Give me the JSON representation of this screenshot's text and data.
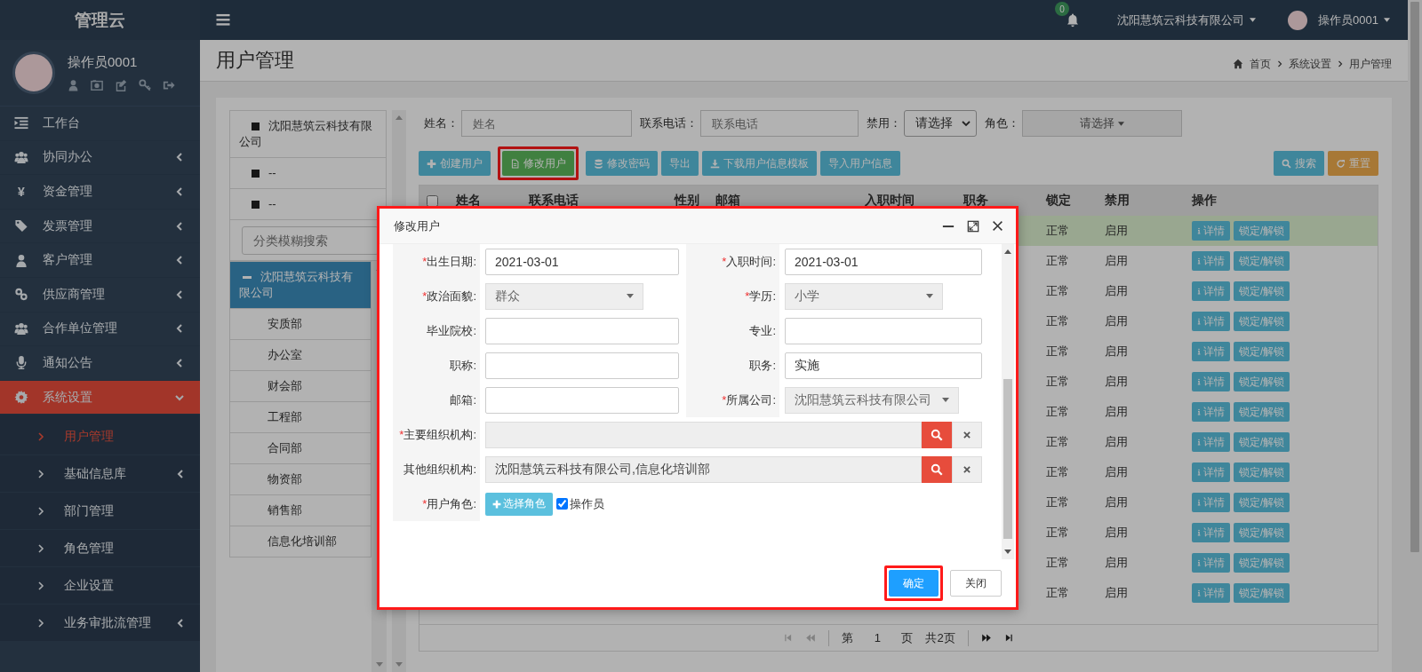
{
  "sidebar": {
    "brand": "管理云",
    "user_name": "操作员0001",
    "menu": [
      {
        "label": "工作台",
        "has_submenu": false,
        "selected": false
      },
      {
        "label": "协同办公",
        "has_submenu": true,
        "expanded": false,
        "selected": false
      },
      {
        "label": "资金管理",
        "glyph": "¥",
        "has_submenu": true,
        "expanded": false,
        "selected": false
      },
      {
        "label": "发票管理",
        "has_submenu": true,
        "expanded": false,
        "selected": false
      },
      {
        "label": "客户管理",
        "has_submenu": true,
        "expanded": false,
        "selected": false
      },
      {
        "label": "供应商管理",
        "has_submenu": true,
        "expanded": false,
        "selected": false
      },
      {
        "label": "合作单位管理",
        "has_submenu": true,
        "expanded": false,
        "selected": false
      },
      {
        "label": "通知公告",
        "has_submenu": true,
        "expanded": false,
        "selected": false
      },
      {
        "label": "系统设置",
        "has_submenu": true,
        "expanded": true,
        "selected": true,
        "children": [
          {
            "label": "用户管理",
            "has_submenu": false,
            "selected": true
          },
          {
            "label": "基础信息库",
            "has_submenu": true,
            "selected": false
          },
          {
            "label": "部门管理",
            "has_submenu": false,
            "selected": false
          },
          {
            "label": "角色管理",
            "has_submenu": false,
            "selected": false
          },
          {
            "label": "企业设置",
            "has_submenu": false,
            "selected": false
          },
          {
            "label": "业务审批流管理",
            "has_submenu": true,
            "selected": false
          }
        ]
      }
    ]
  },
  "topbar": {
    "notification_count": "0",
    "company": "沈阳慧筑云科技有限公司",
    "user_name": "操作员0001"
  },
  "page": {
    "title": "用户管理",
    "breadcrumb": [
      "首页",
      "系统设置",
      "用户管理"
    ]
  },
  "tree": {
    "items": [
      {
        "label": "沈阳慧筑云科技有限公司",
        "expanded": false
      },
      {
        "label": "--",
        "expanded": false
      },
      {
        "label": "--",
        "expanded": false
      }
    ],
    "search": {
      "placeholder": "分类模糊搜索"
    },
    "nodes": [
      {
        "label": "沈阳慧筑云科技有限公司",
        "expanded": true,
        "selected": true,
        "children": [
          {
            "label": "安质部",
            "selected": false
          },
          {
            "label": "办公室",
            "selected": false
          },
          {
            "label": "财会部",
            "selected": false
          },
          {
            "label": "工程部",
            "selected": false
          },
          {
            "label": "合同部",
            "selected": false
          },
          {
            "label": "物资部",
            "selected": false
          },
          {
            "label": "销售部",
            "selected": false
          },
          {
            "label": "信息化培训部",
            "selected": false
          }
        ]
      }
    ]
  },
  "filters": [
    {
      "label": "姓名：",
      "kind": "input",
      "placeholder": "姓名"
    },
    {
      "label": "联系电话：",
      "kind": "input",
      "placeholder": "联系电话"
    },
    {
      "label": "禁用：",
      "kind": "select",
      "value": "请选择"
    },
    {
      "label": "角色：",
      "kind": "dropdown",
      "value": "请选择"
    }
  ],
  "toolbar_left": [
    {
      "label": "创建用户",
      "kind": "info",
      "highlighted": false
    },
    {
      "label": "修改用户",
      "kind": "success",
      "highlighted": true
    },
    {
      "label": "修改密码",
      "kind": "info",
      "highlighted": false
    },
    {
      "label": "导出",
      "kind": "info",
      "highlighted": false
    },
    {
      "label": "下载用户信息模板",
      "kind": "info",
      "highlighted": false
    },
    {
      "label": "导入用户信息",
      "kind": "info",
      "highlighted": false
    }
  ],
  "toolbar_right": [
    {
      "label": "搜索",
      "kind": "info",
      "highlighted": false
    },
    {
      "label": "重置",
      "kind": "warning",
      "highlighted": false
    }
  ],
  "table": {
    "select_all_checked": false,
    "columns": [
      "姓名",
      "联系电话",
      "性别",
      "邮箱",
      "入职时间",
      "职务",
      "锁定",
      "禁用",
      "操作"
    ],
    "rows": [
      {
        "selected": true,
        "locked": "正常",
        "disabled": "启用",
        "actions": [
          "详情",
          "锁定/解锁"
        ]
      },
      {
        "selected": false,
        "locked": "正常",
        "disabled": "启用",
        "actions": [
          "详情",
          "锁定/解锁"
        ]
      },
      {
        "selected": false,
        "locked": "正常",
        "disabled": "启用",
        "actions": [
          "详情",
          "锁定/解锁"
        ]
      },
      {
        "selected": false,
        "locked": "正常",
        "disabled": "启用",
        "actions": [
          "详情",
          "锁定/解锁"
        ]
      },
      {
        "selected": false,
        "locked": "正常",
        "disabled": "启用",
        "actions": [
          "详情",
          "锁定/解锁"
        ]
      },
      {
        "selected": false,
        "locked": "正常",
        "disabled": "启用",
        "actions": [
          "详情",
          "锁定/解锁"
        ]
      },
      {
        "selected": false,
        "locked": "正常",
        "disabled": "启用",
        "actions": [
          "详情",
          "锁定/解锁"
        ]
      },
      {
        "selected": false,
        "locked": "正常",
        "disabled": "启用",
        "actions": [
          "详情",
          "锁定/解锁"
        ]
      },
      {
        "selected": false,
        "locked": "正常",
        "disabled": "启用",
        "actions": [
          "详情",
          "锁定/解锁"
        ]
      },
      {
        "selected": false,
        "locked": "正常",
        "disabled": "启用",
        "actions": [
          "详情",
          "锁定/解锁"
        ]
      },
      {
        "selected": false,
        "locked": "正常",
        "disabled": "启用",
        "actions": [
          "详情",
          "锁定/解锁"
        ]
      },
      {
        "selected": false,
        "locked": "正常",
        "disabled": "启用",
        "actions": [
          "详情",
          "锁定/解锁"
        ]
      },
      {
        "selected": false,
        "locked": "正常",
        "disabled": "启用",
        "actions": [
          "详情",
          "锁定/解锁"
        ]
      }
    ]
  },
  "pagination": {
    "page_prefix": "第",
    "page": "1",
    "page_suffix": "页",
    "total": "共2页",
    "can_go_back": false,
    "can_go_forward": true
  },
  "dialog": {
    "title": "修改用户",
    "highlighted": true,
    "fields": [
      {
        "label": "出生日期:",
        "required_mark": "*",
        "kind": "text",
        "value": "2021-03-01"
      },
      {
        "label": "入职时间:",
        "required_mark": "*",
        "kind": "text",
        "value": "2021-03-01"
      },
      {
        "label": "政治面貌:",
        "required_mark": "*",
        "kind": "select",
        "value": "群众"
      },
      {
        "label": "学历:",
        "required_mark": "*",
        "kind": "select",
        "value": "小学"
      },
      {
        "label": "毕业院校:",
        "kind": "text"
      },
      {
        "label": "专业:",
        "kind": "text"
      },
      {
        "label": "职称:",
        "kind": "text"
      },
      {
        "label": "职务:",
        "kind": "text",
        "value": "实施"
      },
      {
        "label": "邮箱:",
        "kind": "text"
      },
      {
        "label": "所属公司:",
        "required_mark": "*",
        "kind": "select",
        "value": "沈阳慧筑云科技有限公司"
      },
      {
        "label": "主要组织机构:",
        "required_mark": "*",
        "kind": "lookup"
      },
      {
        "label": "其他组织机构:",
        "kind": "lookup",
        "value": "沈阳慧筑云科技有限公司,信息化培训部"
      },
      {
        "label": "用户角色:",
        "required_mark": "*",
        "kind": "roles",
        "button": "选择角色",
        "roles": [
          {
            "label": "操作员",
            "checked": true
          }
        ]
      }
    ],
    "buttons": [
      {
        "label": "确定",
        "kind": "primary",
        "highlighted": true
      },
      {
        "label": "关闭",
        "kind": "default",
        "highlighted": false
      }
    ]
  }
}
